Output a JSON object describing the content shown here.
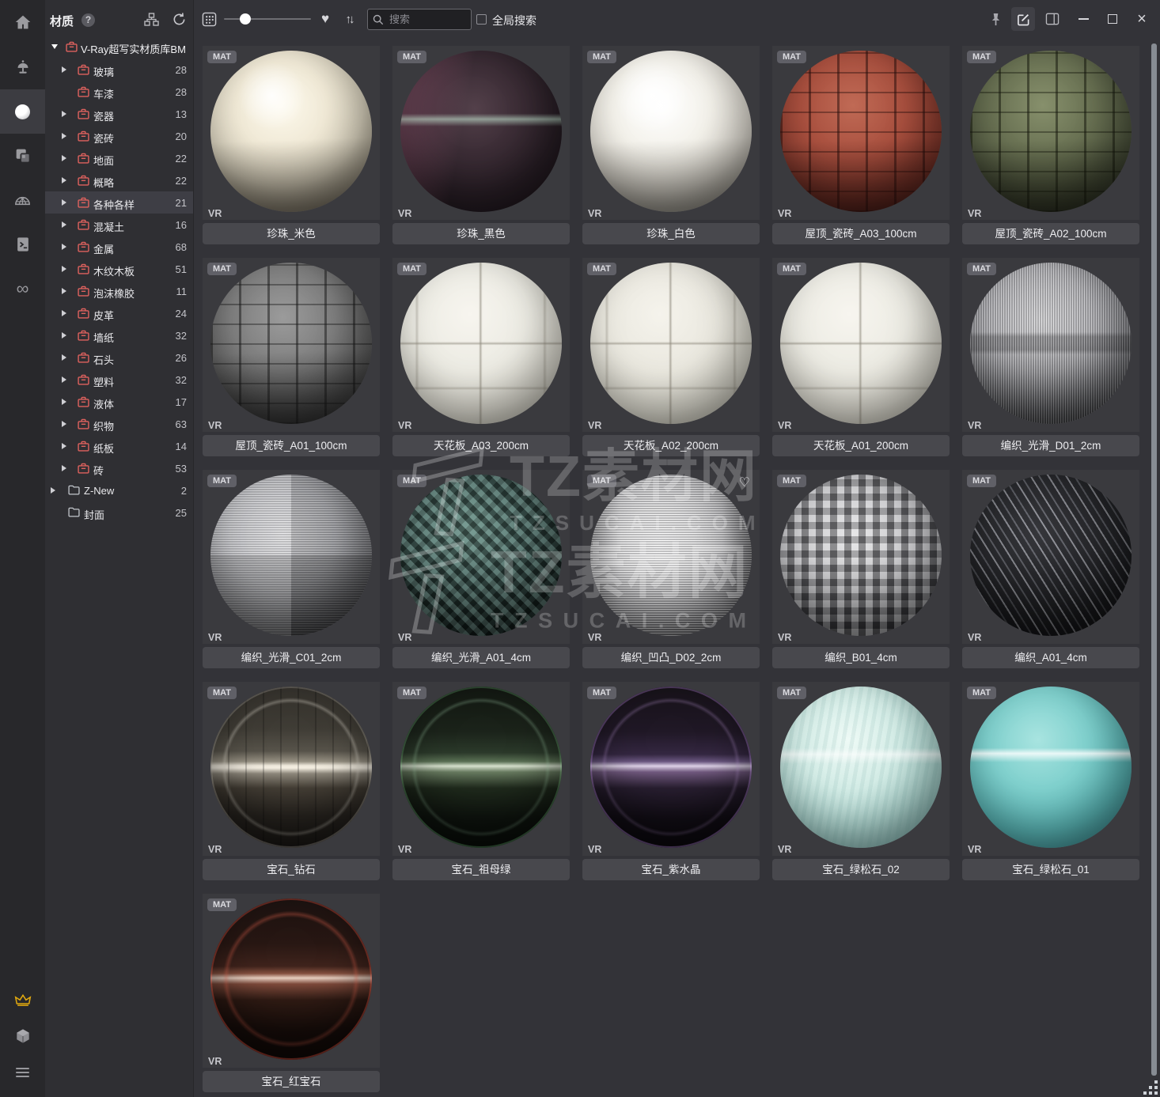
{
  "tree": {
    "title": "材质",
    "root_label": "V-Ray超写实材质库BM",
    "items": [
      {
        "label": "玻璃",
        "count": 28,
        "arrow": true,
        "icon": "case",
        "level": 1
      },
      {
        "label": "车漆",
        "count": 28,
        "arrow": false,
        "icon": "case",
        "level": 1
      },
      {
        "label": "瓷器",
        "count": 13,
        "arrow": true,
        "icon": "case",
        "level": 1
      },
      {
        "label": "瓷砖",
        "count": 20,
        "arrow": true,
        "icon": "case",
        "level": 1
      },
      {
        "label": "地面",
        "count": 22,
        "arrow": true,
        "icon": "case",
        "level": 1
      },
      {
        "label": "概略",
        "count": 22,
        "arrow": true,
        "icon": "case",
        "level": 1
      },
      {
        "label": "各种各样",
        "count": 21,
        "arrow": true,
        "icon": "case",
        "level": 1,
        "selected": true
      },
      {
        "label": "混凝土",
        "count": 16,
        "arrow": true,
        "icon": "case",
        "level": 1
      },
      {
        "label": "金属",
        "count": 68,
        "arrow": true,
        "icon": "case",
        "level": 1
      },
      {
        "label": "木纹木板",
        "count": 51,
        "arrow": true,
        "icon": "case",
        "level": 1
      },
      {
        "label": "泡沫橡胶",
        "count": 11,
        "arrow": true,
        "icon": "case",
        "level": 1
      },
      {
        "label": "皮革",
        "count": 24,
        "arrow": true,
        "icon": "case",
        "level": 1
      },
      {
        "label": "墙纸",
        "count": 32,
        "arrow": true,
        "icon": "case",
        "level": 1
      },
      {
        "label": "石头",
        "count": 26,
        "arrow": true,
        "icon": "case",
        "level": 1
      },
      {
        "label": "塑料",
        "count": 32,
        "arrow": true,
        "icon": "case",
        "level": 1
      },
      {
        "label": "液体",
        "count": 17,
        "arrow": true,
        "icon": "case",
        "level": 1
      },
      {
        "label": "织物",
        "count": 63,
        "arrow": true,
        "icon": "case",
        "level": 1
      },
      {
        "label": "纸板",
        "count": 14,
        "arrow": true,
        "icon": "case",
        "level": 1
      },
      {
        "label": "砖",
        "count": 53,
        "arrow": true,
        "icon": "case",
        "level": 1
      },
      {
        "label": "Z-New",
        "count": 2,
        "arrow": true,
        "icon": "folder",
        "level": 0
      },
      {
        "label": "封面",
        "count": 25,
        "arrow": false,
        "icon": "folder",
        "level": 0
      }
    ]
  },
  "toolbar": {
    "search_placeholder": "搜索",
    "global_search_label": "全局搜索"
  },
  "icons": {
    "heart": "♥",
    "sort": "↑↓",
    "infinity": "∞",
    "help": "?",
    "favorite": "♡",
    "close": "×"
  },
  "grid": {
    "badge": "MAT",
    "renderer": "VR"
  },
  "watermark": {
    "line1": "TZ素材网",
    "line2": "TZSUCAI.COM"
  },
  "colors": {
    "rail_bg": "#28282b",
    "tree_bg": "#2f2f33",
    "main_bg": "#333338",
    "tile_bg": "#3a3a3e",
    "namebar_bg": "#48484d",
    "accent_red_icon": "#e0625e",
    "crown_gold": "#e0a80f",
    "selected_row": "#3e3e45"
  },
  "materials": [
    {
      "name": "珍珠_米色",
      "style": "background:radial-gradient(circle at 38% 28%, rgba(255,255,255,.9) 0%, rgba(255,255,255,0) 22%),linear-gradient(178deg, rgba(55,50,42,0) 55%, rgba(55,50,42,.55) 96%),radial-gradient(circle at 44% 34%, #fdf9ec 0%, #f0e9d6 32%, #d8d1bd 58%, #a79f8c 80%, #7b7566 100%)"
    },
    {
      "name": "珍珠_黑色",
      "style": "background:linear-gradient(180deg, rgba(0,0,0,0) 39%, rgba(215,255,230,.5) 42.5%, rgba(0,0,0,0) 47%),linear-gradient(100deg, rgba(150,90,115,.55) 2%, rgba(150,90,115,0) 40%),radial-gradient(circle at 46% 36%, #53404a 0%, #3c2d36 32%, #271d24 62%, #140f13 100%)"
    },
    {
      "name": "珍珠_白色",
      "style": "background:radial-gradient(circle at 38% 28%, rgba(255,255,255,.95) 0%, rgba(255,255,255,0) 24%),linear-gradient(178deg, rgba(70,68,62,0) 55%, rgba(70,68,62,.5) 96%),radial-gradient(circle at 44% 34%, #ffffff 0%, #f3f1ea 35%, #ddd9d0 62%, #aeaaa0 84%, #84817a 100%)"
    },
    {
      "name": "屋顶_瓷砖_A03_100cm",
      "style": "background:repeating-linear-gradient(90deg, rgba(35,12,10,.5) 0px, rgba(35,12,10,.5) 3px, rgba(0,0,0,0) 3px, rgba(0,0,0,0) 36px),repeating-linear-gradient(0deg, rgba(35,12,10,.4) 0px, rgba(35,12,10,.4) 2px, rgba(0,0,0,0) 2px, rgba(0,0,0,0) 25px),linear-gradient(178deg, rgba(15,5,5,0) 55%, rgba(15,5,5,.5) 97%),radial-gradient(circle at 45% 34%, #c06a55 0%, #a84f3e 38%, #84382c 70%, #5a241d 100%)"
    },
    {
      "name": "屋顶_瓷砖_A02_100cm",
      "style": "background:repeating-linear-gradient(90deg, rgba(18,20,10,.5) 0px, rgba(18,20,10,.5) 3px, rgba(0,0,0,0) 3px, rgba(0,0,0,0) 36px),repeating-linear-gradient(0deg, rgba(18,20,10,.4) 0px, rgba(18,20,10,.4) 2px, rgba(0,0,0,0) 2px, rgba(0,0,0,0) 25px),linear-gradient(178deg, rgba(10,10,5,0) 55%, rgba(10,10,5,.5) 97%),radial-gradient(circle at 45% 34%, #87906c 0%, #676f51 38%, #4a513b 70%, #30342a 100%)"
    },
    {
      "name": "屋顶_瓷砖_A01_100cm",
      "style": "background:repeating-linear-gradient(90deg, rgba(22,22,22,.5) 0px, rgba(22,22,22,.5) 3px, rgba(0,0,0,0) 3px, rgba(0,0,0,0) 36px),repeating-linear-gradient(0deg, rgba(22,22,22,.4) 0px, rgba(22,22,22,.4) 2px, rgba(0,0,0,0) 2px, rgba(0,0,0,0) 25px),linear-gradient(178deg, rgba(10,10,10,0) 55%, rgba(10,10,10,.5) 97%),radial-gradient(circle at 45% 34%, #9b9b9b 0%, #7d7d7d 38%, #585858 70%, #3a3a3a 100%)"
    },
    {
      "name": "天花板_A03_200cm",
      "style": "background:linear-gradient(90deg, rgba(0,0,0,0) 48.6%, rgba(138,133,120,.6) 49.6%, rgba(0,0,0,0) 50.8%),linear-gradient(0deg, rgba(0,0,0,0) 48.8%, rgba(138,133,120,.55) 49.8%, rgba(0,0,0,0) 51%),linear-gradient(0deg, rgba(0,0,0,0) 21%, rgba(138,133,120,.38) 22%, rgba(0,0,0,0) 23.4%),linear-gradient(90deg, rgba(0,0,0,0) 9%, rgba(138,133,120,.35) 10.2%, rgba(0,0,0,0) 11.6%),linear-gradient(90deg, rgba(0,0,0,0) 88.2%, rgba(138,133,120,.35) 89.4%, rgba(0,0,0,0) 90.8%),radial-gradient(circle at 43% 32%, #f7f5ef 0%, #ecebe3 40%, #d8d6cc 68%, #b4b2a6 88%, #93928a 100%)"
    },
    {
      "name": "天花板_A02_200cm",
      "style": "background:linear-gradient(90deg, rgba(0,0,0,0) 48.6%, rgba(138,133,120,.6) 49.6%, rgba(0,0,0,0) 50.8%),linear-gradient(0deg, rgba(0,0,0,0) 48.8%, rgba(138,133,120,.55) 49.8%, rgba(0,0,0,0) 51%),linear-gradient(0deg, rgba(0,0,0,0) 21%, rgba(138,133,120,.38) 22%, rgba(0,0,0,0) 23.4%),linear-gradient(90deg, rgba(0,0,0,0) 9%, rgba(138,133,120,.35) 10.2%, rgba(0,0,0,0) 11.6%),linear-gradient(90deg, rgba(0,0,0,0) 88.2%, rgba(138,133,120,.35) 89.4%, rgba(0,0,0,0) 90.8%),radial-gradient(circle at 43% 32%, #f5f3ec 0%, #eae8df 40%, #d5d3c8 68%, #b1afa3 88%, #908f86 100%)"
    },
    {
      "name": "天花板_A01_200cm",
      "style": "background:linear-gradient(90deg, rgba(0,0,0,0) 48.6%, rgba(138,133,120,.6) 49.6%, rgba(0,0,0,0) 50.8%),linear-gradient(0deg, rgba(0,0,0,0) 48.8%, rgba(138,133,120,.55) 49.8%, rgba(0,0,0,0) 51%),linear-gradient(0deg, rgba(0,0,0,0) 21%, rgba(138,133,120,.38) 22%, rgba(0,0,0,0) 23.4%),radial-gradient(circle at 43% 32%, #f7f5ef 0%, #ecebe3 40%, #d8d6cc 68%, #b4b2a6 88%, #93928a 100%)"
    },
    {
      "name": "编织_光滑_D01_2cm",
      "style": "background:repeating-linear-gradient(90deg, rgba(255,255,255,.2) 0px, rgba(255,255,255,.2) 1px, rgba(20,20,22,.25) 1px, rgba(20,20,22,.25) 3px),linear-gradient(0deg, rgba(0,0,0,0) 43%, rgba(10,10,12,.28) 46%, rgba(10,10,12,.28) 54%, rgba(0,0,0,0) 57%),linear-gradient(178deg, rgba(0,0,0,0) 50%, rgba(0,0,0,.45) 95%),radial-gradient(circle at 44% 36%, #e0e0e2 0%, #bfbfc3 38%, #8e8f94 68%, #5a5b60 100%)"
    },
    {
      "name": "编织_光滑_C01_2cm",
      "style": "background:linear-gradient(90deg, rgba(255,255,255,.14) 0%, rgba(255,255,255,.14) 50%, rgba(0,0,0,.12) 50%, rgba(0,0,0,.12) 100%),linear-gradient(0deg, rgba(0,0,0,.18) 0%, rgba(0,0,0,.18) 50%, rgba(0,0,0,0) 50%, rgba(0,0,0,0) 100%),repeating-linear-gradient(0deg, rgba(255,255,255,.16) 0px, rgba(255,255,255,.16) 1px, rgba(40,40,44,.26) 1px, rgba(40,40,44,.26) 3px),linear-gradient(178deg, rgba(0,0,0,0) 52%, rgba(0,0,0,.4) 96%),radial-gradient(circle at 45% 38%, #e6e6e8 0%, #c2c3c7 40%, #94959a 70%, #5f6065 100%)"
    },
    {
      "name": "编织_光滑_A01_4cm",
      "style": "background:repeating-linear-gradient(45deg, rgba(172,216,206,.24) 0px, rgba(172,216,206,.24) 7px, rgba(8,16,14,.38) 7px, rgba(8,16,14,.38) 14px),repeating-linear-gradient(-45deg, rgba(140,190,180,.16) 0px, rgba(140,190,180,.16) 7px, rgba(8,16,14,.26) 7px, rgba(8,16,14,.26) 14px),linear-gradient(178deg, rgba(0,0,0,0) 45%, rgba(0,0,0,.5) 96%),radial-gradient(circle at 42% 34%, #628078 0%, #425955 38%, #2a3a37 68%, #15201e 100%)"
    },
    {
      "name": "编织_凹凸_D02_2cm",
      "fav": true,
      "style": "background:repeating-linear-gradient(0deg, rgba(255,255,255,.42) 0px, rgba(255,255,255,.42) 1px, rgba(70,70,74,.32) 1px, rgba(70,70,74,.32) 3px),linear-gradient(90deg, rgba(0,0,0,.28) 0%, rgba(0,0,0,0) 18%, rgba(0,0,0,0) 82%, rgba(0,0,0,.3) 100%),linear-gradient(178deg, rgba(0,0,0,0) 55%, rgba(0,0,0,.4) 97%),radial-gradient(circle at 42% 44%, #ffffff 0%, #ebebeb 28%, #c6c6c8 55%, #8f8f93 80%, #5a5a5e 100%)"
    },
    {
      "name": "编织_B01_4cm",
      "style": "background:repeating-linear-gradient(90deg, rgba(255,255,255,.26) 0px, rgba(255,255,255,.26) 9px, rgba(18,18,20,.36) 9px, rgba(18,18,20,.36) 18px),repeating-linear-gradient(0deg, rgba(255,255,255,.16) 0px, rgba(255,255,255,.16) 9px, rgba(22,22,25,.38) 9px, rgba(22,22,25,.38) 18px),linear-gradient(178deg, rgba(0,0,0,0) 50%, rgba(0,0,0,.42) 96%),radial-gradient(circle at 45% 38%, #d9d9db 0%, #b0b0b4 40%, #7c7d82 72%, #46474c 100%)"
    },
    {
      "name": "编织_A01_4cm",
      "style": "background:repeating-linear-gradient(58deg, rgba(208,208,214,.38) 0px, rgba(208,208,214,.38) 2px, rgba(14,14,16,.6) 2px, rgba(14,14,16,.6) 9px, rgba(108,108,114,.28) 9px, rgba(108,108,114,.28) 11px, rgba(14,14,16,.6) 11px, rgba(14,14,16,.6) 19px),linear-gradient(178deg, rgba(0,0,0,0) 48%, rgba(0,0,0,.45) 96%),radial-gradient(circle at 42% 36%, #70727a 0%, #4b4d53 38%, #2d2f33 68%, #17181b 100%)"
    },
    {
      "name": "宝石_钻石",
      "style": "background:radial-gradient(circle at 50% 50%, rgba(0,0,0,0) 56%, rgba(232,227,215,.3) 58.5%, rgba(0,0,0,0) 61%, rgba(0,0,0,0) 73%, rgba(232,227,215,.34) 75.5%, rgba(0,0,0,0) 78%),repeating-linear-gradient(90deg, rgba(0,0,0,.2) 0px, rgba(0,0,0,.2) 2px, rgba(0,0,0,0) 2px, rgba(0,0,0,0) 22px),linear-gradient(180deg, #34312c 0%, #3f3c35 26%, #57534a 40%, #969082 46.5%, #efe9dc 49%, #f5efe2 50.5%, #8d877b 54%, #453f36 63%, #2b2722 80%, #1d1a17 100%);box-shadow:inset 0 0 0 2px rgba(210,205,195,.22), inset 0 -35px 55px rgba(0,0,0,.5)"
    },
    {
      "name": "宝石_祖母绿",
      "style": "background:radial-gradient(circle at 50% 50%, rgba(0,0,0,0) 56%, rgba(180,230,190,.22) 58.5%, rgba(0,0,0,0) 61%, rgba(0,0,0,0) 73%, rgba(180,230,190,.25) 75.5%, rgba(0,0,0,0) 78%),linear-gradient(180deg, #121711 0%, #1b231a 28%, #2b392a 41%, #5a7054 46.5%, #d7e2ce 49.3%, #687b60 53%, #202b1d 63%, #101610 82%, #0a0f0a 100%);box-shadow:inset 0 0 0 2px rgba(120,200,130,.25), inset 0 -35px 55px rgba(0,0,0,.55)"
    },
    {
      "name": "宝石_紫水晶",
      "style": "background:radial-gradient(circle at 50% 50%, rgba(0,0,0,0) 56%, rgba(210,170,240,.22) 58.5%, rgba(0,0,0,0) 61%, rgba(0,0,0,0) 73%, rgba(210,170,240,.28) 75.5%, rgba(0,0,0,0) 78%),linear-gradient(180deg, #171219 0%, #201826 28%, #342741 42%, #6a5680 46.5%, #ded2e8 49.3%, #71597f 53%, #291f31 63%, #140f18 82%, #0d0a10 100%);box-shadow:inset 0 0 0 2px rgba(190,140,230,.3), inset 0 -35px 55px rgba(0,0,0,.55)"
    },
    {
      "name": "宝石_绿松石_02",
      "style": "background:linear-gradient(180deg, rgba(255,255,255,0) 38%, rgba(255,255,255,.6) 42%, rgba(255,255,255,0) 48%),repeating-linear-gradient(100deg, rgba(120,170,165,.14) 0px, rgba(120,170,165,.14) 5px, rgba(0,0,0,0) 5px, rgba(0,0,0,0) 11px),radial-gradient(circle at 42% 33%, #eefaf6 0%, #d3ece6 35%, #abd3cd 62%, #7fadaa 85%, #5e8a89 100%)"
    },
    {
      "name": "宝石_绿松石_01",
      "style": "background:linear-gradient(180deg, rgba(255,255,255,0) 38%, rgba(255,255,255,.8) 41.5%, rgba(255,255,255,0) 47%),radial-gradient(circle at 42% 33%, #a8e4e0 0%, #7fd0cd 35%, #55aeae 65%, #377f84 88%, #26636a 100%)"
    },
    {
      "name": "宝石_红宝石",
      "style": "background:radial-gradient(circle at 50% 50%, rgba(0,0,0,0) 54%, rgba(255,110,85,.28) 57%, rgba(0,0,0,0) 60%, rgba(0,0,0,0) 72%, rgba(255,110,85,.24) 75%, rgba(0,0,0,0) 78%),linear-gradient(180deg, #1c1210 0%, #281713 28%, #3f231c 42%, #85503f 46.5%, #e8cfc0 49.3%, #7e4a3b 53%, #301b14 63%, #190e0b 82%, #120a08 100%);box-shadow:inset 0 0 0 2px rgba(255,90,70,.3), inset 0 -35px 55px rgba(0,0,0,.55)"
    }
  ]
}
